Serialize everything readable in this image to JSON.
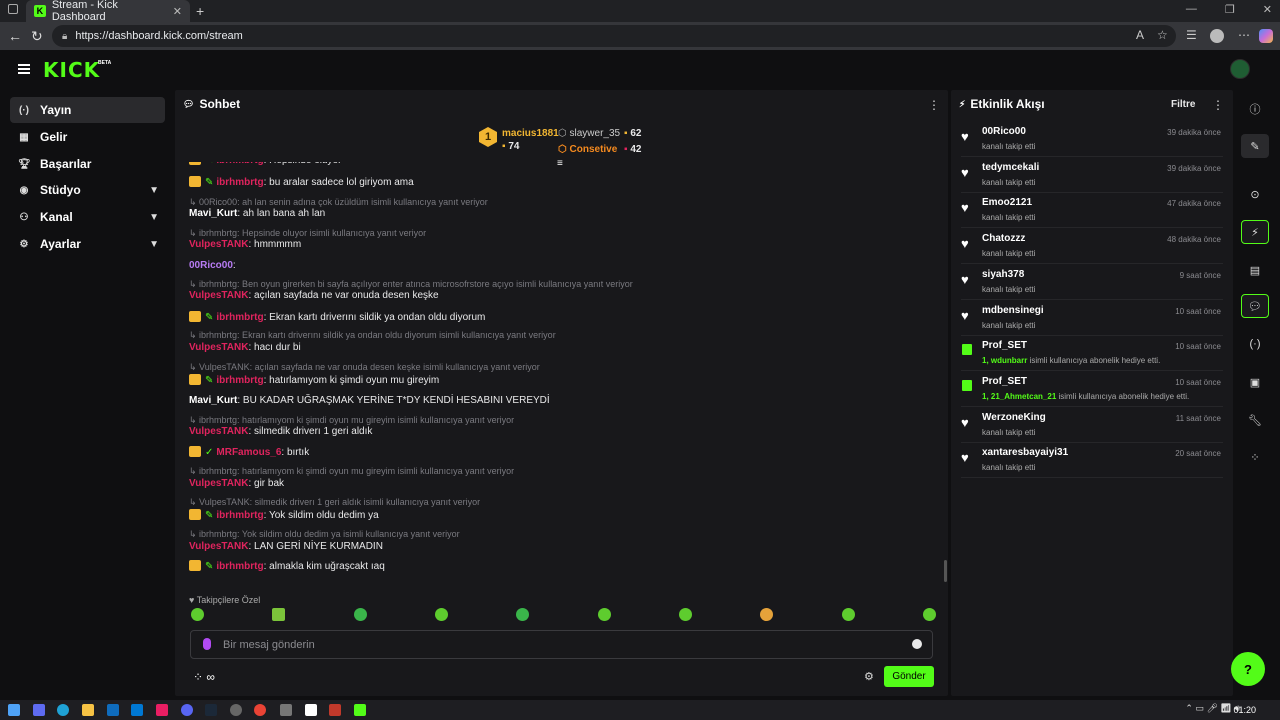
{
  "browser": {
    "tab_title": "Stream - Kick Dashboard",
    "url": "https://dashboard.kick.com/stream"
  },
  "header": {
    "logo": "KICK",
    "beta": "BETA"
  },
  "sidebar": {
    "items": [
      {
        "label": "Yayın",
        "icon": "broadcast-icon",
        "active": true
      },
      {
        "label": "Gelir",
        "icon": "revenue-icon"
      },
      {
        "label": "Başarılar",
        "icon": "trophy-icon"
      },
      {
        "label": "Stüdyo",
        "icon": "studio-icon",
        "expandable": true
      },
      {
        "label": "Kanal",
        "icon": "channel-icon",
        "expandable": true
      },
      {
        "label": "Ayarlar",
        "icon": "settings-icon",
        "expandable": true
      }
    ]
  },
  "chat": {
    "title": "Sohbet",
    "gifters": [
      {
        "rank": "1",
        "name": "macius1881",
        "count": "74"
      },
      {
        "name": "slaywer_35",
        "count": "62"
      },
      {
        "name": "Consetive",
        "count": "42"
      }
    ],
    "followers_only": "Takipçilere Özel",
    "input_placeholder": "Bir mesaj gönderin",
    "send_label": "Gönder",
    "infinity": "∞"
  },
  "messages": [
    {
      "type": "msg",
      "user": "ibrhmbrtg",
      "text": ": Hepsinde oluyor",
      "badges": true
    },
    {
      "type": "msg",
      "user": "ibrhmbrtg",
      "text": ": bu aralar sadece lol giriyom ama",
      "badges": true
    },
    {
      "type": "reply",
      "text": "00Rico00: ah lan senin adına çok üzüldüm isimli kullanıcıya yanıt veriyor"
    },
    {
      "type": "msg",
      "user": "Mavi_Kurt",
      "text": ": ah lan bana ah lan",
      "color": "white"
    },
    {
      "type": "reply",
      "text": "ibrhmbrtg: Hepsinde oluyor isimli kullanıcıya yanıt veriyor"
    },
    {
      "type": "msg",
      "user": "VulpesTANK",
      "text": ": hmmmmm"
    },
    {
      "type": "msg",
      "user": "00Rico00",
      "text": ":",
      "color": "purple"
    },
    {
      "type": "reply",
      "text": "ibrhmbrtg: Ben oyun girerken bi sayfa açılıyor enter atınca microsofrstore açıyo isimli kullanıcıya yanıt veriyor"
    },
    {
      "type": "msg",
      "user": "VulpesTANK",
      "text": ": açılan sayfada ne var onuda desen keşke"
    },
    {
      "type": "msg",
      "user": "ibrhmbrtg",
      "text": ": Ekran kartı driverını sildik ya ondan oldu diyorum",
      "badges": true
    },
    {
      "type": "reply",
      "text": "ibrhmbrtg: Ekran kartı driverını sildik ya ondan oldu diyorum isimli kullanıcıya yanıt veriyor"
    },
    {
      "type": "msg",
      "user": "VulpesTANK",
      "text": ": hacı dur bi"
    },
    {
      "type": "reply",
      "text": "VulpesTANK: açılan sayfada ne var onuda desen keşke isimli kullanıcıya yanıt veriyor"
    },
    {
      "type": "msg",
      "user": "ibrhmbrtg",
      "text": ": hatırlamıyom ki şimdi oyun mu gireyim",
      "badges": true
    },
    {
      "type": "msg",
      "user": "Mavi_Kurt",
      "text": ": BU KADAR UĞRAŞMAK YERİNE T*DY KENDİ HESABINI VEREYDİ",
      "color": "white"
    },
    {
      "type": "reply",
      "text": "ibrhmbrtg: hatırlamıyom ki şimdi oyun mu gireyim isimli kullanıcıya yanıt veriyor"
    },
    {
      "type": "msg",
      "user": "VulpesTANK",
      "text": ": silmedik driverı 1 geri aldık"
    },
    {
      "type": "msg",
      "user": "MRFamous_6",
      "text": ": bırtık",
      "badges": true,
      "v": true
    },
    {
      "type": "reply",
      "text": "ibrhmbrtg: hatırlamıyom ki şimdi oyun mu gireyim isimli kullanıcıya yanıt veriyor"
    },
    {
      "type": "msg",
      "user": "VulpesTANK",
      "text": ": gir bak"
    },
    {
      "type": "reply",
      "text": "VulpesTANK: silmedik driverı 1 geri aldık isimli kullanıcıya yanıt veriyor"
    },
    {
      "type": "msg",
      "user": "ibrhmbrtg",
      "text": ": Yok sildim oldu dedim ya",
      "badges": true
    },
    {
      "type": "reply",
      "text": "ibrhmbrtg: Yok sildim oldu dedim ya isimli kullanıcıya yanıt veriyor"
    },
    {
      "type": "msg",
      "user": "VulpesTANK",
      "text": ": LAN GERİ NİYE KURMADIN"
    },
    {
      "type": "msg",
      "user": "ibrhmbrtg",
      "text": ": almakla kim uğraşcakt ıaq",
      "badges": true
    }
  ],
  "activity": {
    "title": "Etkinlik Akışı",
    "filter": "Filtre",
    "items": [
      {
        "kind": "follow",
        "name": "00Rico00",
        "desc": "kanalı takip etti",
        "time": "39 dakika önce"
      },
      {
        "kind": "follow",
        "name": "tedymcekali",
        "desc": "kanalı takip etti",
        "time": "39 dakika önce"
      },
      {
        "kind": "follow",
        "name": "Emoo2121",
        "desc": "kanalı takip etti",
        "time": "47 dakika önce"
      },
      {
        "kind": "follow",
        "name": "Chatozzz",
        "desc": "kanalı takip etti",
        "time": "48 dakika önce"
      },
      {
        "kind": "follow",
        "name": "siyah378",
        "desc": "kanalı takip etti",
        "time": "9 saat önce"
      },
      {
        "kind": "follow",
        "name": "mdbensinegi",
        "desc": "kanalı takip etti",
        "time": "10 saat önce"
      },
      {
        "kind": "gift",
        "name": "Prof_SET",
        "hl": "1, wdunbarr",
        "desc": " isimli kullanıcıya abonelik hediye etti.",
        "time": "10 saat önce"
      },
      {
        "kind": "gift",
        "name": "Prof_SET",
        "hl": "1, 21_Ahmetcan_21",
        "desc": " isimli kullanıcıya abonelik hediye etti.",
        "time": "10 saat önce"
      },
      {
        "kind": "follow",
        "name": "WerzoneKing",
        "desc": "kanalı takip etti",
        "time": "11 saat önce"
      },
      {
        "kind": "follow",
        "name": "xantaresbayaiyi31",
        "desc": "kanalı takip etti",
        "time": "20 saat önce"
      }
    ]
  },
  "taskbar": {
    "time": "01:20"
  },
  "colors": {
    "accent": "#53fc18",
    "username_red": "#e0245e",
    "username_purple": "#b87cf5",
    "panel": "#18181b"
  }
}
